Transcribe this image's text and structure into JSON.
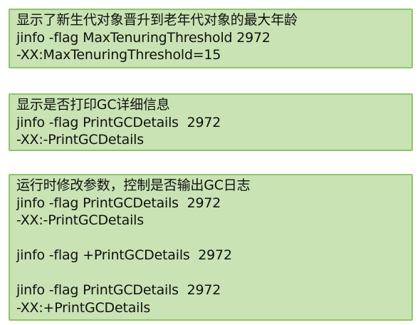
{
  "colors": {
    "card_background": "#c9e3b4",
    "card_border": "#8fc46a",
    "text": "#111111"
  },
  "cards": [
    {
      "lines": [
        "显示了新生代对象晋升到老年代对象的最大年龄",
        "jinfo -flag MaxTenuringThreshold 2972",
        "-XX:MaxTenuringThreshold=15"
      ]
    },
    {
      "lines": [
        "显示是否打印GC详细信息",
        "jinfo -flag PrintGCDetails  2972",
        "-XX:-PrintGCDetails"
      ]
    },
    {
      "lines": [
        "运行时修改参数，控制是否输出GC日志",
        "jinfo -flag PrintGCDetails  2972",
        "-XX:-PrintGCDetails",
        "jinfo -flag +PrintGCDetails  2972",
        "jinfo -flag PrintGCDetails  2972",
        "-XX:+PrintGCDetails"
      ]
    }
  ]
}
